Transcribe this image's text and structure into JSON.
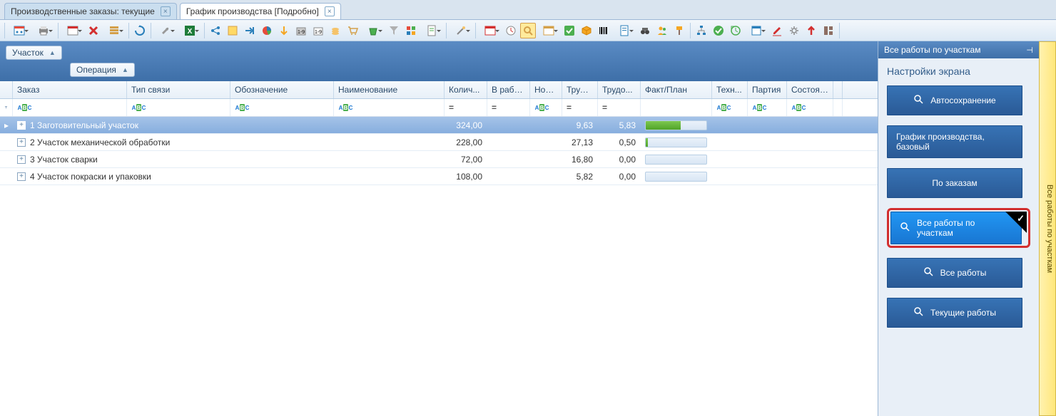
{
  "tabs": [
    {
      "label": "Производственные заказы: текущие",
      "active": false
    },
    {
      "label": "График производства [Подробно]",
      "active": true
    }
  ],
  "grouping": {
    "chip1": "Участок",
    "chip2": "Операция"
  },
  "columns": {
    "order": "Заказ",
    "type": "Тип связи",
    "desig": "Обозначение",
    "name": "Наименование",
    "qty": "Колич...",
    "inwork": "В работе",
    "nom": "Ном...",
    "labor1": "Трудо...",
    "labor2": "Трудо...",
    "fact": "Факт/План",
    "tech": "Техн...",
    "batch": "Партия",
    "state": "Состояни..."
  },
  "rows": [
    {
      "num": "1",
      "label": "Заготовительный участок",
      "qty": "324,00",
      "labor1": "9,63",
      "labor2": "5,83",
      "progress": 58,
      "selected": true
    },
    {
      "num": "2",
      "label": "Участок механической обработки",
      "qty": "228,00",
      "labor1": "27,13",
      "labor2": "0,50",
      "progress": 3,
      "selected": false
    },
    {
      "num": "3",
      "label": "Участок  сварки",
      "qty": "72,00",
      "labor1": "16,80",
      "labor2": "0,00",
      "progress": 0,
      "selected": false
    },
    {
      "num": "4",
      "label": "Участок покраски и упаковки",
      "qty": "108,00",
      "labor1": "5,82",
      "labor2": "0,00",
      "progress": 0,
      "selected": false
    }
  ],
  "side": {
    "header": "Все работы по участкам",
    "title": "Настройки экрана",
    "buttons": {
      "autosave": "Автосохранение",
      "base": "График производства, базовый",
      "orders": "По заказам",
      "allByArea": "Все работы по участкам",
      "allWorks": "Все работы",
      "current": "Текущие работы"
    }
  },
  "sideTab": "Все работы по участкам"
}
